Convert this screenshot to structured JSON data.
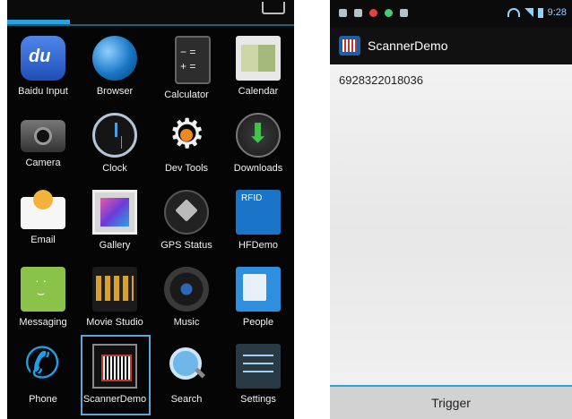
{
  "left_screen": {
    "apps": [
      {
        "label": "Baidu Input",
        "icon": "baidu-input-icon"
      },
      {
        "label": "Browser",
        "icon": "globe-icon"
      },
      {
        "label": "Calculator",
        "icon": "calculator-icon"
      },
      {
        "label": "Calendar",
        "icon": "calendar-icon"
      },
      {
        "label": "Camera",
        "icon": "camera-icon"
      },
      {
        "label": "Clock",
        "icon": "clock-icon"
      },
      {
        "label": "Dev Tools",
        "icon": "gear-icon"
      },
      {
        "label": "Downloads",
        "icon": "download-icon"
      },
      {
        "label": "Email",
        "icon": "envelope-icon"
      },
      {
        "label": "Gallery",
        "icon": "gallery-icon"
      },
      {
        "label": "GPS Status",
        "icon": "satellite-icon"
      },
      {
        "label": "HFDemo",
        "icon": "rfid-icon"
      },
      {
        "label": "Messaging",
        "icon": "chat-icon"
      },
      {
        "label": "Movie Studio",
        "icon": "clapperboard-icon"
      },
      {
        "label": "Music",
        "icon": "speaker-icon"
      },
      {
        "label": "People",
        "icon": "contacts-icon"
      },
      {
        "label": "Phone",
        "icon": "phone-icon"
      },
      {
        "label": "ScannerDemo",
        "icon": "barcode-icon",
        "selected": true
      },
      {
        "label": "Search",
        "icon": "magnifier-icon"
      },
      {
        "label": "Settings",
        "icon": "settings-sliders-icon"
      }
    ]
  },
  "right_screen": {
    "status_bar": {
      "time": "9:28"
    },
    "action_bar": {
      "title": "ScannerDemo",
      "icon": "barcode-icon"
    },
    "content": {
      "scan_result": "6928322018036"
    },
    "trigger_button": {
      "label": "Trigger"
    }
  },
  "colors": {
    "accent": "#2aa4e0",
    "selection": "#5aa6d6"
  }
}
